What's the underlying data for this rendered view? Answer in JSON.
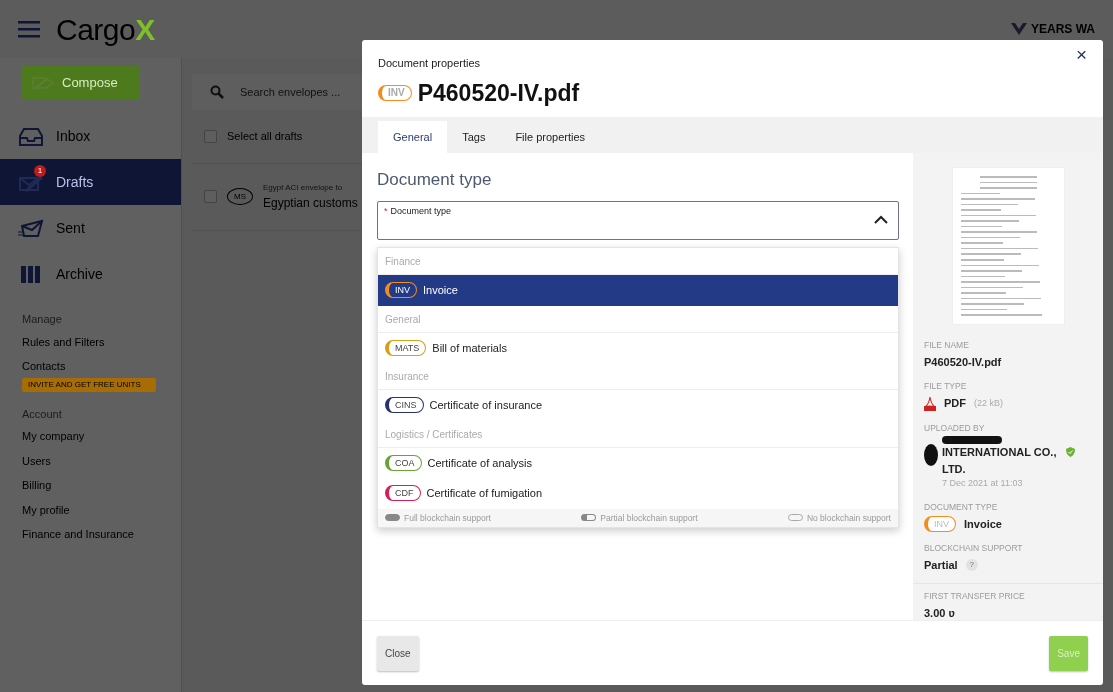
{
  "app": {
    "logo": {
      "text": "Cargo",
      "mark": "X"
    },
    "banner": "YEARS WA",
    "compose": "Compose",
    "nav": [
      {
        "label": "Inbox",
        "selected": false
      },
      {
        "label": "Drafts",
        "selected": true,
        "badge": "1"
      },
      {
        "label": "Sent",
        "selected": false
      },
      {
        "label": "Archive",
        "selected": false
      }
    ],
    "sections": [
      {
        "title": "Manage",
        "links": [
          {
            "label": "Rules and Filters"
          },
          {
            "label": "Contacts",
            "tag": "INVITE AND GET FREE UNITS"
          }
        ]
      },
      {
        "title": "Account",
        "links": [
          {
            "label": "My company"
          },
          {
            "label": "Users"
          },
          {
            "label": "Billing"
          },
          {
            "label": "My profile"
          }
        ]
      },
      {
        "links": [
          {
            "label": "Finance and Insurance"
          }
        ]
      }
    ],
    "search": {
      "placeholder": "Search envelopes ..."
    },
    "select_all": {
      "label": "Select all drafts",
      "checked": false
    },
    "envelopes": [
      {
        "logo": "MS",
        "subtitle": "Egypt ACI envelope to",
        "title": "Egyptian customs",
        "checked": false
      }
    ]
  },
  "modal": {
    "close": "×",
    "overline": "Document properties",
    "badge": "INV",
    "title": "P460520-IV.pdf",
    "tabs": [
      {
        "label": "General",
        "selected": true
      },
      {
        "label": "Tags",
        "selected": false
      },
      {
        "label": "File properties",
        "selected": false
      }
    ],
    "section_title": "Document type",
    "field": {
      "label": "Document type",
      "required_mark": "*",
      "expanded": true
    },
    "dropdown": [
      {
        "kind": "group",
        "label": "Finance"
      },
      {
        "kind": "option",
        "code": "INV",
        "label": "Invoice",
        "color": "#f28c1e",
        "selected": true
      },
      {
        "kind": "group",
        "label": "General"
      },
      {
        "kind": "option",
        "code": "MATS",
        "label": "Bill of materials",
        "color": "#d4a017",
        "selected": false
      },
      {
        "kind": "group",
        "label": "Insurance"
      },
      {
        "kind": "option",
        "code": "CINS",
        "label": "Certificate of insurance",
        "color": "#26336e",
        "selected": false
      },
      {
        "kind": "group",
        "label": "Logistics / Certificates"
      },
      {
        "kind": "option",
        "code": "COA",
        "label": "Certificate of analysis",
        "color": "#6aa335",
        "selected": false
      },
      {
        "kind": "option",
        "code": "CDF",
        "label": "Certificate of fumigation",
        "color": "#d61f5a",
        "selected": false
      }
    ],
    "legend": [
      {
        "kind": "full",
        "label": "Full blockchain support"
      },
      {
        "kind": "partial",
        "label": "Partial blockchain support"
      },
      {
        "kind": "none",
        "label": "No blockchain support"
      }
    ],
    "details": [
      {
        "kind": "text",
        "label": "FILE NAME",
        "value": "P460520-IV.pdf"
      },
      {
        "kind": "filetype",
        "label": "FILE TYPE",
        "value": "PDF",
        "note": "(22 kB)"
      },
      {
        "kind": "uploader",
        "label": "UPLOADED BY",
        "value": "INTERNATIONAL CO., LTD.",
        "date": "7 Dec 2021 at 11:03",
        "verified": true
      },
      {
        "kind": "doctype",
        "label": "DOCUMENT TYPE",
        "code": "INV",
        "color": "#f28c1e",
        "value": "Invoice"
      },
      {
        "kind": "help",
        "label": "BLOCKCHAIN SUPPORT",
        "value": "Partial",
        "help": "?"
      },
      {
        "kind": "price",
        "label": "FIRST TRANSFER PRICE",
        "value": "3.00 ʋ"
      }
    ],
    "buttons": [
      {
        "kind": "secondary",
        "label": "Close",
        "disabled": false
      },
      {
        "kind": "primary",
        "label": "Save",
        "disabled": true
      }
    ]
  }
}
